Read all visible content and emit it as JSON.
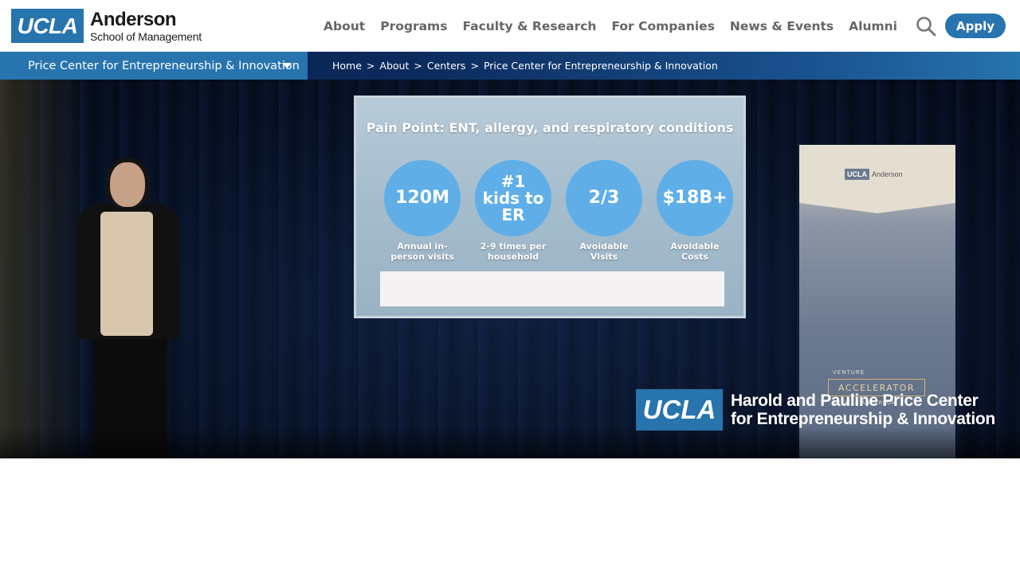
{
  "header": {
    "logo": {
      "mark": "UCLA",
      "name": "Anderson",
      "subtitle": "School of Management"
    },
    "nav": [
      {
        "label": "About"
      },
      {
        "label": "Programs"
      },
      {
        "label": "Faculty & Research"
      },
      {
        "label": "For Companies"
      },
      {
        "label": "News & Events"
      },
      {
        "label": "Alumni"
      }
    ],
    "search_icon": "search-icon",
    "apply_label": "Apply"
  },
  "subbar": {
    "center_label": "Price Center for Entrepreneurship & Innovation",
    "breadcrumb": [
      {
        "label": "Home"
      },
      {
        "label": "About"
      },
      {
        "label": "Centers"
      },
      {
        "label": "Price Center for Entrepreneurship & Innovation"
      }
    ],
    "separator": ">"
  },
  "hero": {
    "screen": {
      "title": "Pain Point: ENT, allergy, and respiratory conditions",
      "stats": [
        {
          "value": "120M",
          "label": "Annual in-person visits"
        },
        {
          "value": "#1 kids to ER",
          "label": "2-9 times per household"
        },
        {
          "value": "2/3",
          "label": "Avoidable Visits"
        },
        {
          "value": "$18B+",
          "label": "Avoidable Costs"
        }
      ]
    },
    "banner": {
      "logo_mark": "UCLA",
      "logo_name": "Anderson",
      "venture": "VENTURE",
      "accelerator": "ACCELERATOR",
      "at": "AT UCLA ANDERSON"
    },
    "overlay": {
      "mark": "UCLA",
      "line1": "Harold and Pauline Price Center",
      "line2": "for Entrepreneurship & Innovation"
    }
  },
  "colors": {
    "brand_blue": "#2774ae",
    "nav_text": "#666666"
  }
}
